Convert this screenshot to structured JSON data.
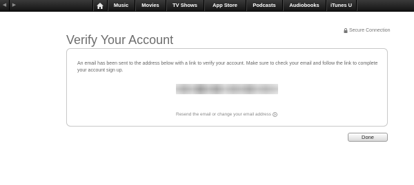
{
  "topnav": {
    "back_icon": "back-arrow-icon",
    "forward_icon": "forward-arrow-icon",
    "home_icon": "home-icon",
    "items": [
      "Music",
      "Movies",
      "TV Shows",
      "App Store",
      "Podcasts",
      "Audiobooks",
      "iTunes U"
    ]
  },
  "header": {
    "title": "Verify Your Account",
    "secure_label": "Secure Connection",
    "lock_icon": "lock-icon"
  },
  "card": {
    "message": "An email has been sent to the address below with a link to verify your account. Make sure to check your email and follow the link to complete your account sign up.",
    "resend_link": "Resend the email or change your email address",
    "arrow_icon": "circle-arrow-right-icon"
  },
  "actions": {
    "done_label": "Done"
  },
  "colors": {
    "topbar": "#1c1c1c",
    "title": "#6d6d6d",
    "text": "#666666",
    "border": "#c8c8c8"
  }
}
